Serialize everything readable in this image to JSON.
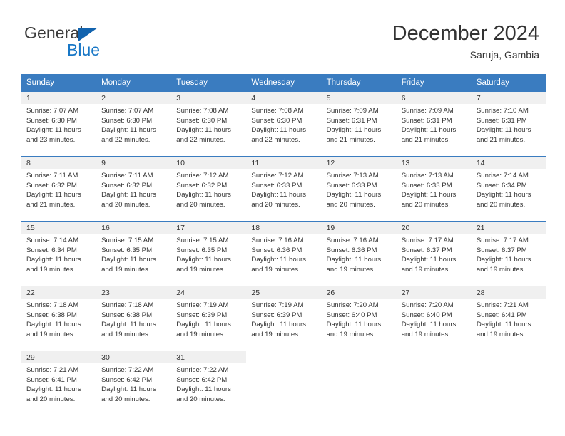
{
  "logo": {
    "word_one": "General",
    "word_two": "Blue",
    "triangle_icon": "triangle-icon",
    "accent_color": "#1263ae",
    "blue_text_color": "#1877c6"
  },
  "header": {
    "title": "December 2024",
    "location": "Saruja, Gambia",
    "header_bg_color": "#3a7cc0",
    "band_color": "#f0f0f0"
  },
  "weekdays": [
    "Sunday",
    "Monday",
    "Tuesday",
    "Wednesday",
    "Thursday",
    "Friday",
    "Saturday"
  ],
  "labels": {
    "sunrise_prefix": "Sunrise:",
    "sunset_prefix": "Sunset:",
    "daylight_prefix": "Daylight:"
  },
  "weeks": [
    [
      {
        "day": "1",
        "sunrise": "Sunrise: 7:07 AM",
        "sunset": "Sunset: 6:30 PM",
        "daylight_line1": "Daylight: 11 hours",
        "daylight_line2": "and 23 minutes."
      },
      {
        "day": "2",
        "sunrise": "Sunrise: 7:07 AM",
        "sunset": "Sunset: 6:30 PM",
        "daylight_line1": "Daylight: 11 hours",
        "daylight_line2": "and 22 minutes."
      },
      {
        "day": "3",
        "sunrise": "Sunrise: 7:08 AM",
        "sunset": "Sunset: 6:30 PM",
        "daylight_line1": "Daylight: 11 hours",
        "daylight_line2": "and 22 minutes."
      },
      {
        "day": "4",
        "sunrise": "Sunrise: 7:08 AM",
        "sunset": "Sunset: 6:30 PM",
        "daylight_line1": "Daylight: 11 hours",
        "daylight_line2": "and 22 minutes."
      },
      {
        "day": "5",
        "sunrise": "Sunrise: 7:09 AM",
        "sunset": "Sunset: 6:31 PM",
        "daylight_line1": "Daylight: 11 hours",
        "daylight_line2": "and 21 minutes."
      },
      {
        "day": "6",
        "sunrise": "Sunrise: 7:09 AM",
        "sunset": "Sunset: 6:31 PM",
        "daylight_line1": "Daylight: 11 hours",
        "daylight_line2": "and 21 minutes."
      },
      {
        "day": "7",
        "sunrise": "Sunrise: 7:10 AM",
        "sunset": "Sunset: 6:31 PM",
        "daylight_line1": "Daylight: 11 hours",
        "daylight_line2": "and 21 minutes."
      }
    ],
    [
      {
        "day": "8",
        "sunrise": "Sunrise: 7:11 AM",
        "sunset": "Sunset: 6:32 PM",
        "daylight_line1": "Daylight: 11 hours",
        "daylight_line2": "and 21 minutes."
      },
      {
        "day": "9",
        "sunrise": "Sunrise: 7:11 AM",
        "sunset": "Sunset: 6:32 PM",
        "daylight_line1": "Daylight: 11 hours",
        "daylight_line2": "and 20 minutes."
      },
      {
        "day": "10",
        "sunrise": "Sunrise: 7:12 AM",
        "sunset": "Sunset: 6:32 PM",
        "daylight_line1": "Daylight: 11 hours",
        "daylight_line2": "and 20 minutes."
      },
      {
        "day": "11",
        "sunrise": "Sunrise: 7:12 AM",
        "sunset": "Sunset: 6:33 PM",
        "daylight_line1": "Daylight: 11 hours",
        "daylight_line2": "and 20 minutes."
      },
      {
        "day": "12",
        "sunrise": "Sunrise: 7:13 AM",
        "sunset": "Sunset: 6:33 PM",
        "daylight_line1": "Daylight: 11 hours",
        "daylight_line2": "and 20 minutes."
      },
      {
        "day": "13",
        "sunrise": "Sunrise: 7:13 AM",
        "sunset": "Sunset: 6:33 PM",
        "daylight_line1": "Daylight: 11 hours",
        "daylight_line2": "and 20 minutes."
      },
      {
        "day": "14",
        "sunrise": "Sunrise: 7:14 AM",
        "sunset": "Sunset: 6:34 PM",
        "daylight_line1": "Daylight: 11 hours",
        "daylight_line2": "and 20 minutes."
      }
    ],
    [
      {
        "day": "15",
        "sunrise": "Sunrise: 7:14 AM",
        "sunset": "Sunset: 6:34 PM",
        "daylight_line1": "Daylight: 11 hours",
        "daylight_line2": "and 19 minutes."
      },
      {
        "day": "16",
        "sunrise": "Sunrise: 7:15 AM",
        "sunset": "Sunset: 6:35 PM",
        "daylight_line1": "Daylight: 11 hours",
        "daylight_line2": "and 19 minutes."
      },
      {
        "day": "17",
        "sunrise": "Sunrise: 7:15 AM",
        "sunset": "Sunset: 6:35 PM",
        "daylight_line1": "Daylight: 11 hours",
        "daylight_line2": "and 19 minutes."
      },
      {
        "day": "18",
        "sunrise": "Sunrise: 7:16 AM",
        "sunset": "Sunset: 6:36 PM",
        "daylight_line1": "Daylight: 11 hours",
        "daylight_line2": "and 19 minutes."
      },
      {
        "day": "19",
        "sunrise": "Sunrise: 7:16 AM",
        "sunset": "Sunset: 6:36 PM",
        "daylight_line1": "Daylight: 11 hours",
        "daylight_line2": "and 19 minutes."
      },
      {
        "day": "20",
        "sunrise": "Sunrise: 7:17 AM",
        "sunset": "Sunset: 6:37 PM",
        "daylight_line1": "Daylight: 11 hours",
        "daylight_line2": "and 19 minutes."
      },
      {
        "day": "21",
        "sunrise": "Sunrise: 7:17 AM",
        "sunset": "Sunset: 6:37 PM",
        "daylight_line1": "Daylight: 11 hours",
        "daylight_line2": "and 19 minutes."
      }
    ],
    [
      {
        "day": "22",
        "sunrise": "Sunrise: 7:18 AM",
        "sunset": "Sunset: 6:38 PM",
        "daylight_line1": "Daylight: 11 hours",
        "daylight_line2": "and 19 minutes."
      },
      {
        "day": "23",
        "sunrise": "Sunrise: 7:18 AM",
        "sunset": "Sunset: 6:38 PM",
        "daylight_line1": "Daylight: 11 hours",
        "daylight_line2": "and 19 minutes."
      },
      {
        "day": "24",
        "sunrise": "Sunrise: 7:19 AM",
        "sunset": "Sunset: 6:39 PM",
        "daylight_line1": "Daylight: 11 hours",
        "daylight_line2": "and 19 minutes."
      },
      {
        "day": "25",
        "sunrise": "Sunrise: 7:19 AM",
        "sunset": "Sunset: 6:39 PM",
        "daylight_line1": "Daylight: 11 hours",
        "daylight_line2": "and 19 minutes."
      },
      {
        "day": "26",
        "sunrise": "Sunrise: 7:20 AM",
        "sunset": "Sunset: 6:40 PM",
        "daylight_line1": "Daylight: 11 hours",
        "daylight_line2": "and 19 minutes."
      },
      {
        "day": "27",
        "sunrise": "Sunrise: 7:20 AM",
        "sunset": "Sunset: 6:40 PM",
        "daylight_line1": "Daylight: 11 hours",
        "daylight_line2": "and 19 minutes."
      },
      {
        "day": "28",
        "sunrise": "Sunrise: 7:21 AM",
        "sunset": "Sunset: 6:41 PM",
        "daylight_line1": "Daylight: 11 hours",
        "daylight_line2": "and 19 minutes."
      }
    ],
    [
      {
        "day": "29",
        "sunrise": "Sunrise: 7:21 AM",
        "sunset": "Sunset: 6:41 PM",
        "daylight_line1": "Daylight: 11 hours",
        "daylight_line2": "and 20 minutes."
      },
      {
        "day": "30",
        "sunrise": "Sunrise: 7:22 AM",
        "sunset": "Sunset: 6:42 PM",
        "daylight_line1": "Daylight: 11 hours",
        "daylight_line2": "and 20 minutes."
      },
      {
        "day": "31",
        "sunrise": "Sunrise: 7:22 AM",
        "sunset": "Sunset: 6:42 PM",
        "daylight_line1": "Daylight: 11 hours",
        "daylight_line2": "and 20 minutes."
      },
      {
        "day": "",
        "sunrise": "",
        "sunset": "",
        "daylight_line1": "",
        "daylight_line2": ""
      },
      {
        "day": "",
        "sunrise": "",
        "sunset": "",
        "daylight_line1": "",
        "daylight_line2": ""
      },
      {
        "day": "",
        "sunrise": "",
        "sunset": "",
        "daylight_line1": "",
        "daylight_line2": ""
      },
      {
        "day": "",
        "sunrise": "",
        "sunset": "",
        "daylight_line1": "",
        "daylight_line2": ""
      }
    ]
  ]
}
